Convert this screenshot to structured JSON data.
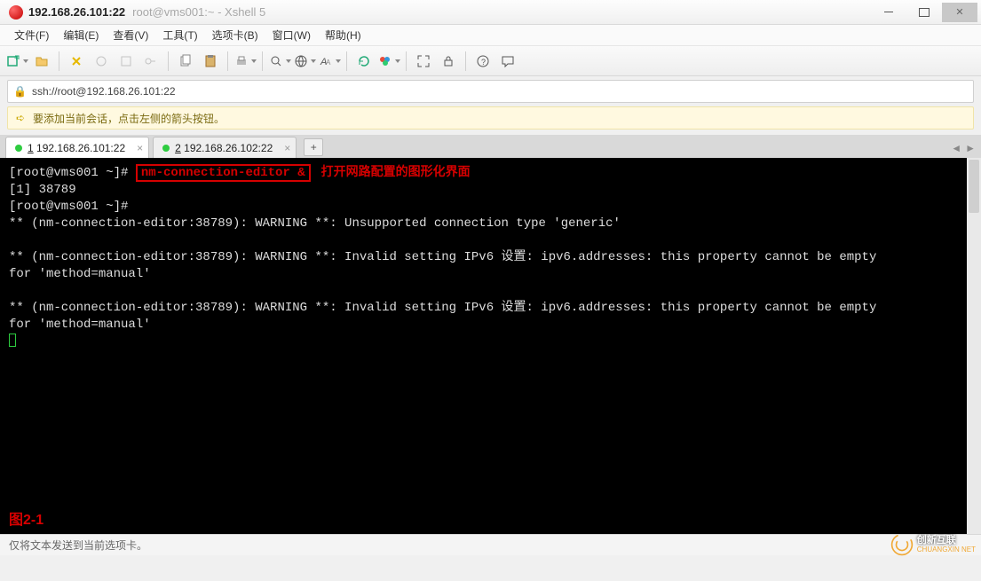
{
  "window": {
    "title_strong": "192.168.26.101:22",
    "title_sub": "root@vms001:~ - Xshell 5"
  },
  "menus": {
    "file": "文件(F)",
    "edit": "编辑(E)",
    "view": "查看(V)",
    "tools": "工具(T)",
    "tabs": "选项卡(B)",
    "window": "窗口(W)",
    "help": "帮助(H)"
  },
  "address": {
    "url": "ssh://root@192.168.26.101:22"
  },
  "hint": {
    "text": "要添加当前会话，点击左侧的箭头按钮。"
  },
  "session_tabs": {
    "tab1_prefix": "1",
    "tab1_label": " 192.168.26.101:22",
    "tab2_prefix": "2",
    "tab2_label": " 192.168.26.102:22",
    "add": "+"
  },
  "terminal": {
    "line1_prompt": "[root@vms001 ~]# ",
    "cmd_highlight": "nm-connection-editor &",
    "annotation": "打开网路配置的图形化界面",
    "line2": "[1] 38789",
    "line3": "[root@vms001 ~]# ",
    "line4": "** (nm-connection-editor:38789): WARNING **: Unsupported connection type 'generic'",
    "blank": "",
    "line5a": "** (nm-connection-editor:38789): WARNING **: Invalid setting IPv6 设置: ipv6.addresses: this property cannot be empty",
    "line5b": "for 'method=manual'",
    "line6a": "** (nm-connection-editor:38789): WARNING **: Invalid setting IPv6 设置: ipv6.addresses: this property cannot be empty",
    "line6b": "for 'method=manual'",
    "figure_label": "图2-1"
  },
  "statusbar": {
    "text": "仅将文本发送到当前选项卡。"
  },
  "watermark": {
    "brand": "创新互联",
    "sub": "CHUANGXIN NET"
  }
}
